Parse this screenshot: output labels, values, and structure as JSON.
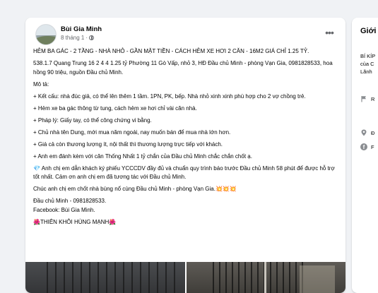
{
  "post": {
    "author": "Bùi Gia Minh",
    "timestamp": "8 tháng 1",
    "separator": "·",
    "more_icon": "more-horizontal-icon",
    "paragraphs": [
      "HẺM BA GÁC - 2 TẦNG - NHÀ NHỎ - GẦN MẶT TIỀN - CÁCH HẺM XE HƠI 2 CĂN - 16M2 GIÁ CHỈ 1.25 TỶ.",
      "538.1.7 Quang Trung 16 2 4 4 1.25 tỷ Phường 11 Gò Vấp, nhỏ 3, HĐ Đầu chủ Minh - phòng Vạn Gia, 0981828533, hoa hồng 90 triệu, nguồn Đầu chủ Minh.",
      "Mô tả:",
      "+ Kết cấu: nhà đúc giả, có thể lên thêm 1 tầm. 1PN, PK, bếp. Nhà nhỏ xinh xinh phù hợp cho 2 vợ chồng trẻ.",
      "+ Hẻm xe ba gác thông từ tung, cách hẻm xe hơi chỉ vài căn nhà.",
      "+ Pháp lý: Giấy tay, có thể công chứng vi bằng.",
      "+ Chủ nhà tên Dung, mới mua năm ngoái, nay muốn bán để mua nhà lớn hơn.",
      "+ Giá cả còn thương lượng ít, nội thất thì thương lượng trực tiếp với khách.",
      "+ Anh em đánh kèm với căn Thống Nhất 1 tỷ chắn của Đầu chủ Minh chắc chắn chốt ạ.",
      "💎 Anh chị em dẫn khách ký phiếu YCCCDV đầy đủ và chuẩn quy trình báo trước Đầu chủ Minh 58 phút để được hỗ trợ tốt nhất. Cảm ơn anh chị em đã tương tác với Đầu chủ Minh.",
      "Chúc anh chị em chốt nhà bùng nổ cùng Đầu chủ Minh - phòng Vạn Gia.💥💥💥"
    ],
    "contact_name": "Đầu chủ Minh - 0981828533.",
    "facebook": "Facebook: Bùi Gia Minh.",
    "signature": "🌺THIÊN KHÔI HÙNG MẠNH🌺"
  },
  "sidebar": {
    "title": "Giới",
    "desc": [
      "BÍ KÍP",
      "của C",
      "Lãnh"
    ],
    "rows": [
      {
        "icon": "flag-icon",
        "label": "R"
      },
      {
        "icon": "location-pin-icon",
        "label": "Đ"
      },
      {
        "icon": "facebook-icon",
        "label": "F"
      }
    ]
  }
}
